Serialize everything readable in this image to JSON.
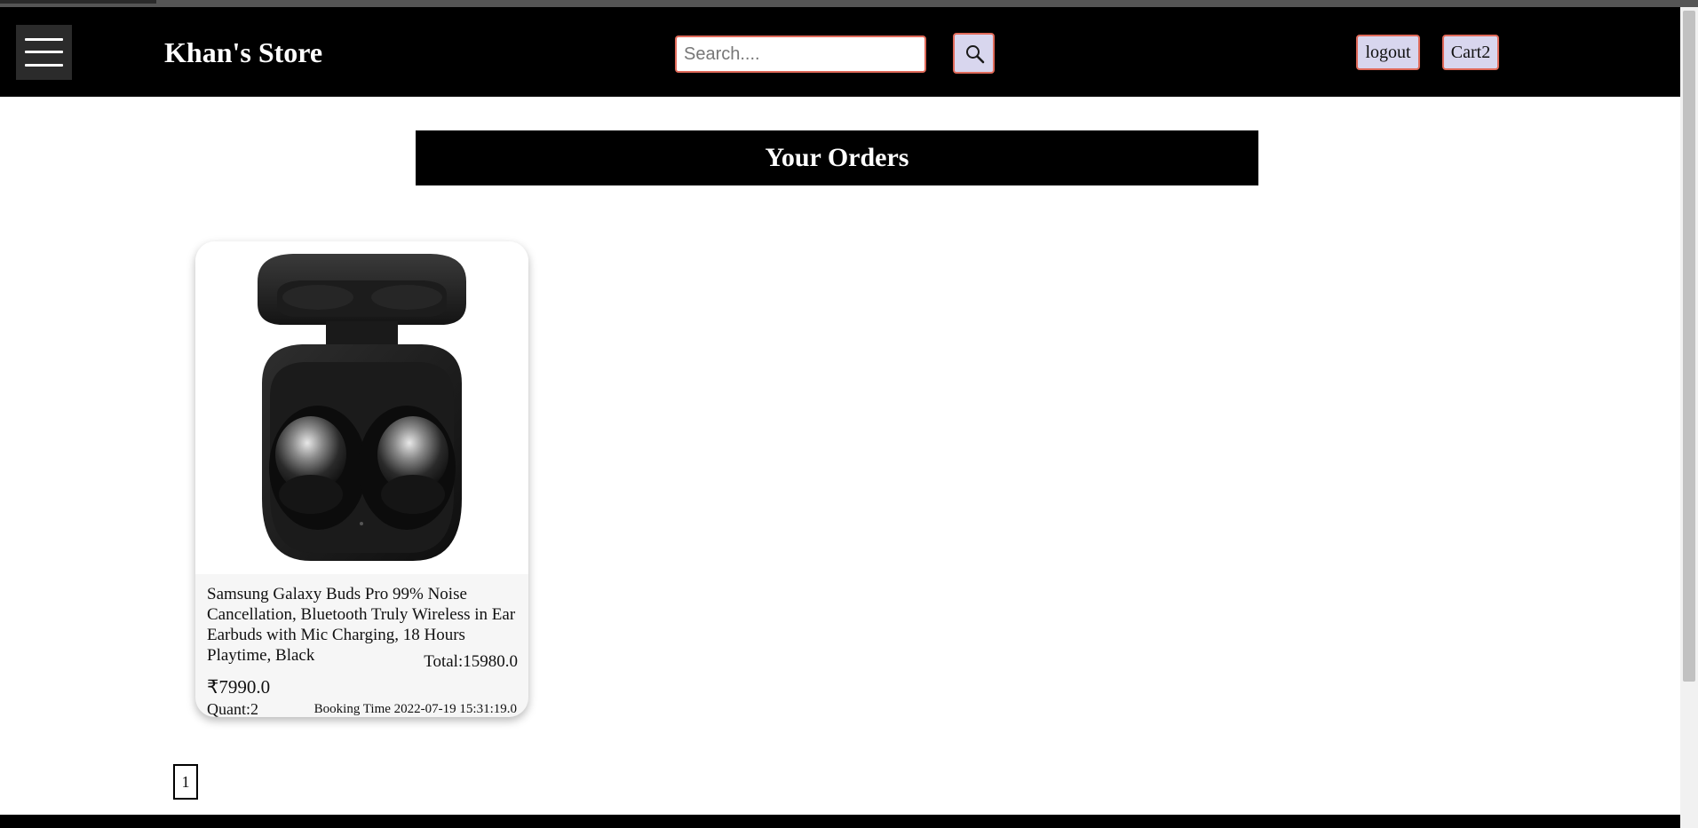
{
  "navbar": {
    "menu_icon": "hamburger-menu-icon",
    "brand": "Khan's Store",
    "search_placeholder": "Search....",
    "search_value": "",
    "search_icon": "magnifier-icon",
    "logout_label": "logout",
    "cart_label": "Cart2"
  },
  "orders": {
    "heading": "Your Orders",
    "items": [
      {
        "image_icon": "earbuds-case-image",
        "title": "Samsung Galaxy Buds Pro 99% Noise Cancellation, Bluetooth Truly Wireless in Ear Earbuds with Mic Charging, 18 Hours Playtime, Black",
        "total": "Total:15980.0",
        "price": "₹7990.0",
        "quantity": "Quant:2",
        "booking_time": "Booking Time 2022-07-19 15:31:19.0"
      }
    ]
  },
  "pagination": {
    "pages": [
      "1"
    ]
  },
  "colors": {
    "navbar_bg": "#000000",
    "button_bg": "#d8d6ee",
    "button_border": "#e06a5a",
    "card_bg": "#f6f6f6"
  }
}
